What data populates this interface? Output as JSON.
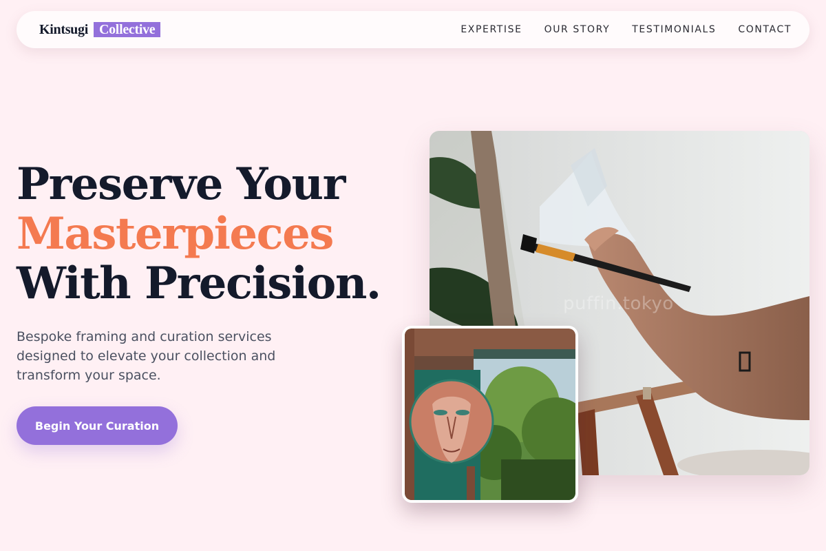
{
  "nav": {
    "logo_primary": "Kintsugi",
    "logo_accent": "Collective",
    "links": [
      {
        "label": "EXPERTISE"
      },
      {
        "label": "OUR STORY"
      },
      {
        "label": "TESTIMONIALS"
      },
      {
        "label": "CONTACT"
      }
    ]
  },
  "hero": {
    "headline_line1": "Preserve Your",
    "headline_line2": "Masterpieces",
    "headline_line3": "With Precision.",
    "subtitle": "Bespoke framing and curation services designed to elevate your collection and transform your space.",
    "cta_label": "Begin Your Curation"
  },
  "images": {
    "main": {
      "depicts": "painting-on-easel-photo",
      "watermark": "puffin.tokyo"
    },
    "inset": {
      "depicts": "painted-face-artwork-photo"
    }
  },
  "colors": {
    "background": "#fff0f4",
    "brand_purple": "#9370db",
    "accent_orange": "#f47a50",
    "text_dark": "#141a2b",
    "text_muted": "#4a5060"
  }
}
